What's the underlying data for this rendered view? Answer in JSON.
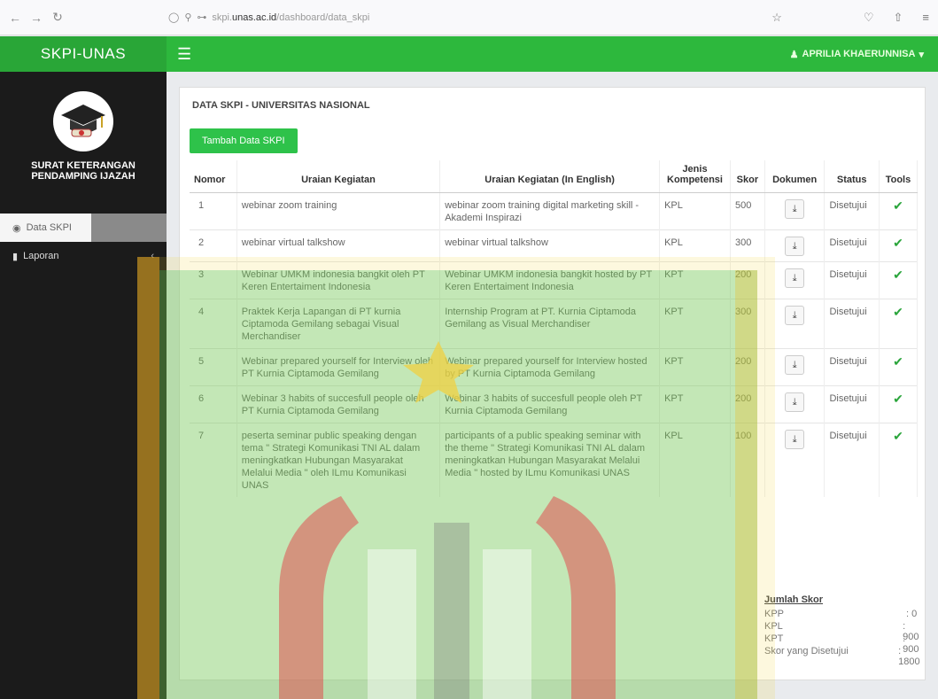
{
  "browser": {
    "url_prefix": "skpi.",
    "url_domain": "unas.ac.id",
    "url_path": "/dashboard/data_skpi"
  },
  "header": {
    "brand": "SKPI-UNAS",
    "user": "APRILIA KHAERUNNISA"
  },
  "sidebar": {
    "title_line1": "SURAT KETERANGAN",
    "title_line2": "PENDAMPING IJAZAH",
    "items": [
      {
        "label": "Data SKPI"
      },
      {
        "label": "Laporan"
      }
    ]
  },
  "main": {
    "title": "DATA SKPI - UNIVERSITAS NASIONAL",
    "add_button": "Tambah Data SKPI",
    "columns": [
      "Nomor",
      "Uraian Kegiatan",
      "Uraian Kegiatan (In English)",
      "Jenis Kompetensi",
      "Skor",
      "Dokumen",
      "Status",
      "Tools"
    ],
    "rows": [
      {
        "no": "1",
        "uraian": "webinar zoom training",
        "english": "webinar zoom training digital marketing skill - Akademi Inspirazi",
        "jenis": "KPL",
        "skor": "500",
        "status": "Disetujui"
      },
      {
        "no": "2",
        "uraian": "webinar virtual talkshow",
        "english": "webinar virtual talkshow",
        "jenis": "KPL",
        "skor": "300",
        "status": "Disetujui"
      },
      {
        "no": "3",
        "uraian": "Webinar UMKM indonesia bangkit oleh PT Keren Entertaiment Indonesia",
        "english": "Webinar UMKM indonesia bangkit hosted by PT Keren Entertaiment Indonesia",
        "jenis": "KPT",
        "skor": "200",
        "status": "Disetujui"
      },
      {
        "no": "4",
        "uraian": "Praktek Kerja Lapangan di PT kurnia Ciptamoda Gemilang sebagai Visual Merchandiser",
        "english": "Internship Program at PT. Kurnia Ciptamoda Gemilang as Visual Merchandiser",
        "jenis": "KPT",
        "skor": "300",
        "status": "Disetujui"
      },
      {
        "no": "5",
        "uraian": "Webinar prepared yourself for Interview oleh PT Kurnia Ciptamoda Gemilang",
        "english": "Webinar prepared yourself for Interview hosted by PT Kurnia Ciptamoda Gemilang",
        "jenis": "KPT",
        "skor": "200",
        "status": "Disetujui"
      },
      {
        "no": "6",
        "uraian": "Webinar 3 habits of succesfull people oleh PT Kurnia Ciptamoda Gemilang",
        "english": "Webinar 3 habits of succesfull people oleh PT Kurnia Ciptamoda Gemilang",
        "jenis": "KPT",
        "skor": "200",
        "status": "Disetujui"
      },
      {
        "no": "7",
        "uraian": "peserta seminar public speaking dengan tema \" Strategi Komunikasi TNI AL dalam meningkatkan Hubungan Masyarakat Melalui Media \" oleh ILmu Komunikasi UNAS",
        "english": "participants of a public speaking seminar with the theme \" Strategi Komunikasi TNI AL dalam meningkatkan Hubungan Masyarakat Melalui Media \" hosted by ILmu Komunikasi UNAS",
        "jenis": "KPL",
        "skor": "100",
        "status": "Disetujui"
      }
    ],
    "summary": {
      "title": "Jumlah Skor",
      "items": [
        {
          "label": "KPP",
          "value": ": 0"
        },
        {
          "label": "KPL",
          "value": ": 900"
        },
        {
          "label": "KPT",
          "value": ": 900"
        },
        {
          "label": "Skor yang Disetujui",
          "value": ": 1800"
        }
      ]
    }
  },
  "colors": {
    "header_green": "#2db83d",
    "sidebar_dark": "#1b1b1b",
    "button_green": "#2ec24a"
  }
}
